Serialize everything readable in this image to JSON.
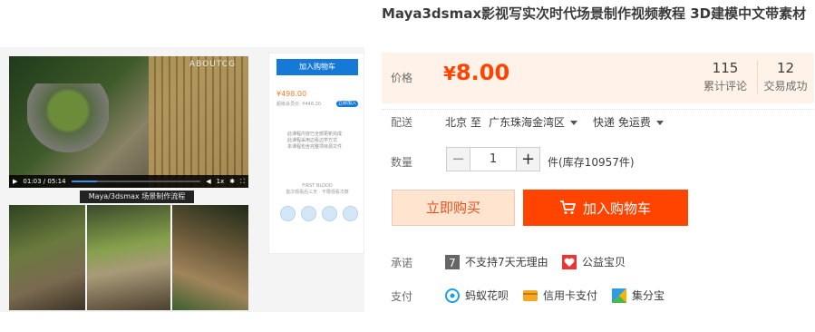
{
  "product": {
    "title": "Maya3dsmax影视写实次时代场景制作视频教程 3D建模中文带素材"
  },
  "preview": {
    "watermark": "ABOUTCG",
    "time": "01:03 / 05:14",
    "speed": "1x",
    "caption": "Maya/3dsmax 场景制作流程",
    "progress": 0.2
  },
  "mini_card": {
    "add_label": "加入购物车",
    "price": "¥498.00",
    "sub": "超级会员价: ¥448.20",
    "pill": "立即加入",
    "lines": [
      "此课程内容已全部更新完成",
      "此课程采用边看边学方式",
      "本课程包含完整项目源文件"
    ],
    "fb_title": "FIRST BLOOD",
    "fb_sub": "首次观看后三天 · 不限观看次数"
  },
  "price_box": {
    "label": "价格",
    "currency": "¥",
    "value": "8.00",
    "reviews_count": "115",
    "reviews_label": "累计评论",
    "sales_count": "12",
    "sales_label": "交易成功"
  },
  "shipping": {
    "label": "配送",
    "from": "北京 至",
    "to": "广东珠海金湾区",
    "method": "快递 免运费"
  },
  "quantity": {
    "label": "数量",
    "minus": "−",
    "value": "1",
    "plus": "+",
    "stock": "件(库存10957件)"
  },
  "actions": {
    "buy_now": "立即购买",
    "add_to_cart": "加入购物车"
  },
  "promise": {
    "label": "承诺",
    "items": [
      "不支持7天无理由",
      "公益宝贝"
    ]
  },
  "payment": {
    "label": "支付",
    "items": [
      "蚂蚁花呗",
      "信用卡支付",
      "集分宝"
    ]
  },
  "colors": {
    "accent": "#ff4400",
    "price_bg": "#fff2e8",
    "mini_btn": "#1479d7"
  }
}
